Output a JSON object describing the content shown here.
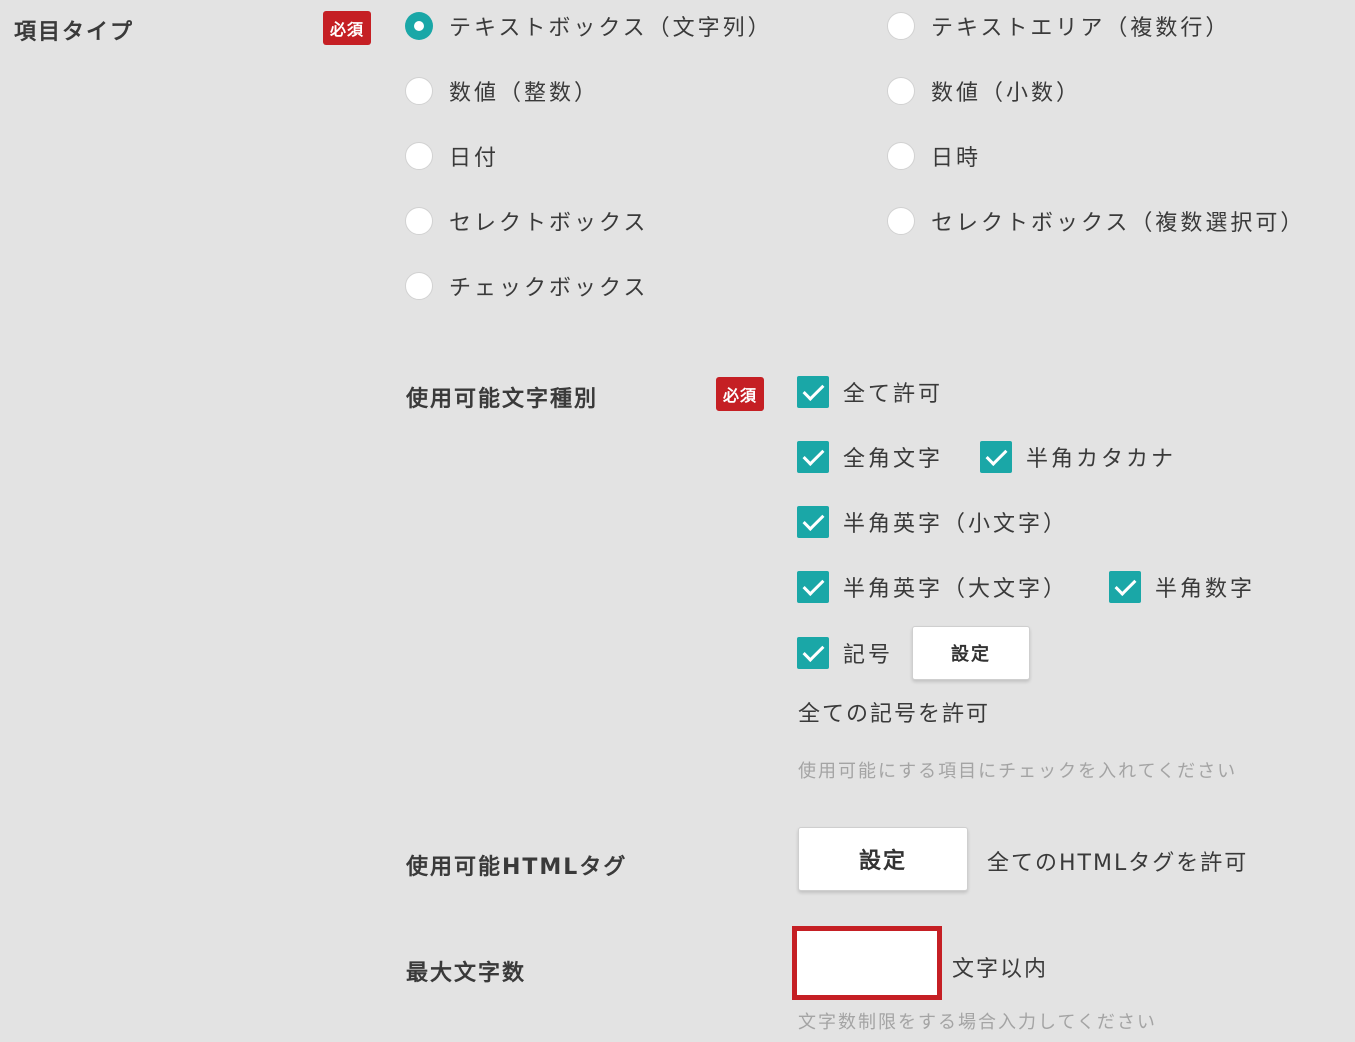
{
  "item_type": {
    "label": "項目タイプ",
    "required_badge": "必須",
    "options": [
      {
        "label": "テキストボックス（文字列）",
        "checked": true
      },
      {
        "label": "テキストエリア（複数行）",
        "checked": false
      },
      {
        "label": "数値（整数）",
        "checked": false
      },
      {
        "label": "数値（小数）",
        "checked": false
      },
      {
        "label": "日付",
        "checked": false
      },
      {
        "label": "日時",
        "checked": false
      },
      {
        "label": "セレクトボックス",
        "checked": false
      },
      {
        "label": "セレクトボックス（複数選択可）",
        "checked": false
      },
      {
        "label": "チェックボックス",
        "checked": false
      }
    ]
  },
  "char_types": {
    "label": "使用可能文字種別",
    "required_badge": "必須",
    "options": [
      {
        "label": "全て許可",
        "checked": true
      },
      {
        "label": "全角文字",
        "checked": true
      },
      {
        "label": "半角カタカナ",
        "checked": true
      },
      {
        "label": "半角英字（小文字）",
        "checked": true
      },
      {
        "label": "半角英字（大文字）",
        "checked": true
      },
      {
        "label": "半角数字",
        "checked": true
      },
      {
        "label": "記号",
        "checked": true
      }
    ],
    "symbol_settings_button": "設定",
    "symbol_status": "全ての記号を許可",
    "hint": "使用可能にする項目にチェックを入れてください"
  },
  "html_tags": {
    "label": "使用可能HTMLタグ",
    "settings_button": "設定",
    "status": "全てのHTMLタグを許可"
  },
  "max_chars": {
    "label": "最大文字数",
    "value": "",
    "placeholder": "",
    "suffix": "文字以内",
    "hint": "文字数制限をする場合入力してください"
  },
  "colors": {
    "accent": "#1aa7a7",
    "required": "#c51f24",
    "background": "#e3e3e3"
  }
}
